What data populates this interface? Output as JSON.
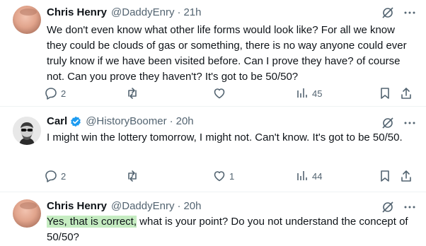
{
  "tweets": [
    {
      "name": "Chris Henry",
      "handle": "@DaddyEnry",
      "dot": "·",
      "time": "21h",
      "text": "We don't even know what other life forms would look like? For all we know they could be clouds of gas or something, there is no way anyone could ever truly know if we have been visited before. Can I prove they have? of course not. Can you prove they haven't? It's got to be 50/50?",
      "replies": "2",
      "retweets": "",
      "likes": "",
      "views": "45"
    },
    {
      "name": "Carl",
      "verified": true,
      "handle": "@HistoryBoomer",
      "dot": "·",
      "time": "20h",
      "text": "I might win the lottery tomorrow, I might not. Can't know. It's got to be 50/50.",
      "replies": "2",
      "retweets": "",
      "likes": "1",
      "views": "44"
    },
    {
      "name": "Chris Henry",
      "handle": "@DaddyEnry",
      "dot": "·",
      "time": "20h",
      "text_highlight": "Yes, that is correct,",
      "text_rest": " what is your point? Do you not understand the concept of 50/50?"
    }
  ],
  "icons": {
    "grok": "grok-icon",
    "more": "more-icon",
    "reply": "reply-icon",
    "retweet": "retweet-icon",
    "like": "like-icon",
    "views": "views-icon",
    "bookmark": "bookmark-icon",
    "share": "share-icon"
  },
  "colors": {
    "text": "#0f1419",
    "secondary": "#536471",
    "verified": "#1d9bf0",
    "highlight": "#c5ecc1"
  }
}
